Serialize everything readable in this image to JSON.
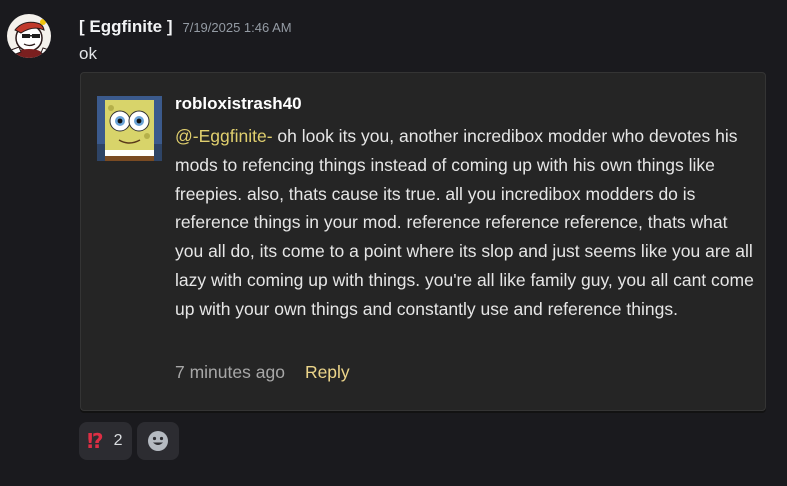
{
  "message": {
    "author": "[ Eggfinite ]",
    "timestamp": "7/19/2025 1:46 AM",
    "text": "ok",
    "avatar_icon": "cartoon-avatar-icon"
  },
  "embed": {
    "author": "robloxistrash40",
    "avatar_icon": "spongebob-avatar-icon",
    "mention": "@-Eggfinite-",
    "body": " oh look its you, another incredibox modder who devotes his mods to refencing things instead of coming up with his own things like freepies. also, thats cause its true. all you incredibox modders do is reference things in your mod. reference reference reference, thats what you all do, its come to a point where its slop and just seems like you are all lazy with coming up with things. you're all like family guy, you all cant come up with your own things and constantly use and reference things.",
    "footer_time": "7 minutes ago",
    "reply_label": "Reply"
  },
  "reactions": [
    {
      "emoji_icon": "exclamation-question-mark-icon",
      "emoji": "⁉",
      "count": "2"
    }
  ],
  "add_reaction_icon": "add-reaction-icon",
  "colors": {
    "background": "#1a1a1e",
    "embed_background": "#252525",
    "mention": "#e0cf6e",
    "reply_link": "#ecd58a",
    "reaction_emoji": "#dd2e44"
  }
}
